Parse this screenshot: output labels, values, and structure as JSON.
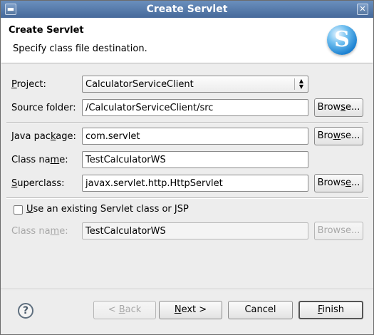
{
  "window": {
    "title": "Create Servlet",
    "menu_icon": "window-menu-icon",
    "close_icon": "close-icon",
    "close_glyph": "✕"
  },
  "header": {
    "title": "Create Servlet",
    "description": "Specify class file destination.",
    "logo_icon": "servlet-logo-icon",
    "logo_glyph": "S"
  },
  "form": {
    "project": {
      "label_pre": "",
      "label_u": "P",
      "label_post": "roject:",
      "value": "CalculatorServiceClient"
    },
    "source_folder": {
      "label": "Source folder:",
      "value": "/CalculatorServiceClient/src",
      "browse": {
        "pre": "Brow",
        "u": "s",
        "post": "e..."
      }
    },
    "java_package": {
      "label_pre": "Java pac",
      "label_u": "k",
      "label_post": "age:",
      "value": "com.servlet",
      "browse": {
        "pre": "Bro",
        "u": "w",
        "post": "se..."
      }
    },
    "class_name": {
      "label_pre": "Class na",
      "label_u": "m",
      "label_post": "e:",
      "value": "TestCalculatorWS"
    },
    "superclass": {
      "label_pre": "",
      "label_u": "S",
      "label_post": "uperclass:",
      "value": "javax.servlet.http.HttpServlet",
      "browse": {
        "pre": "Brows",
        "u": "e",
        "post": "..."
      }
    },
    "existing": {
      "label_pre": "",
      "label_u": "U",
      "label_post": "se an existing Servlet class or JSP",
      "checked": false
    },
    "existing_class_name": {
      "label_pre": "Class na",
      "label_u": "m",
      "label_post": "e:",
      "value": "TestCalculatorWS",
      "browse": "Browse..."
    }
  },
  "footer": {
    "help_icon": "help-icon",
    "help_glyph": "?",
    "back": {
      "pre": "< ",
      "u": "B",
      "post": "ack"
    },
    "next": {
      "pre": "",
      "u": "N",
      "post": "ext >"
    },
    "cancel": "Cancel",
    "finish": {
      "pre": "",
      "u": "F",
      "post": "inish"
    }
  }
}
